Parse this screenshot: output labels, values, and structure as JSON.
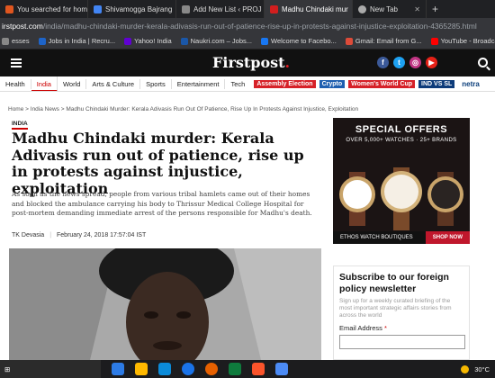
{
  "browser": {
    "tabs": [
      {
        "label": "You searched for hom",
        "color": "#e0561f"
      },
      {
        "label": "Shivamogga Bajrang",
        "color": "#4285f4"
      },
      {
        "label": "Add New List ‹ PROJ",
        "color": "#888888"
      },
      {
        "label": "Madhu Chindaki mur",
        "color": "#d21e1e"
      },
      {
        "label": "New Tab",
        "color": "#aaaaaa"
      }
    ],
    "url_domain": "irstpost.com",
    "url_path": "/india/madhu-chindaki-murder-kerala-adivasis-run-out-of-patience-rise-up-in-protests-against-injustice-exploitation-4365285.html",
    "bookmarks": [
      {
        "label": "esses",
        "color": "#888888"
      },
      {
        "label": "Jobs in India | Recru...",
        "color": "#1e64c8"
      },
      {
        "label": "Yahoo! India",
        "color": "#6001d2"
      },
      {
        "label": "Naukri.com – Jobs...",
        "color": "#1a57a8"
      },
      {
        "label": "Welcome to Facebo...",
        "color": "#1877f2"
      },
      {
        "label": "Gmail: Email from G...",
        "color": "#dd4b39"
      },
      {
        "label": "YouTube - Broadcas...",
        "color": "#ff0000"
      }
    ]
  },
  "site": {
    "logo": "Firstpost",
    "logo_dot": ".",
    "social": [
      {
        "glyph": "f",
        "color": "#3b5998",
        "name": "facebook"
      },
      {
        "glyph": "t",
        "color": "#1da1f2",
        "name": "twitter"
      },
      {
        "glyph": "◎",
        "color": "#c13584",
        "name": "instagram"
      },
      {
        "glyph": "▶",
        "color": "#e62117",
        "name": "youtube"
      }
    ],
    "nav": [
      "Health",
      "India",
      "World",
      "Arts & Culture",
      "Sports",
      "Entertainment",
      "Tech"
    ],
    "nav_selected": "India",
    "pills": [
      {
        "label": "Assembly Election",
        "color": "#d62128"
      },
      {
        "label": "Crypto",
        "color": "#1f5fb0"
      },
      {
        "label": "Women's World Cup",
        "color": "#d62128"
      },
      {
        "label": "IND VS SL",
        "color": "#0d3b7a"
      }
    ],
    "netra": "netra"
  },
  "article": {
    "breadcrumb": [
      "Home",
      "India News",
      "Madhu Chindaki Murder: Kerala Adivasis Run Out Of Patience, Rise Up In Protests Against Injustice, Exploitation"
    ],
    "tag": "INDIA",
    "headline": "Madhu Chindaki murder: Kerala Adivasis run out of patience, rise up in protests against injustice, exploitation",
    "summary": "As soon as the news spread, people from various tribal hamlets came out of their homes and blocked the ambulance carrying his body to Thrissur Medical College Hospital for post-mortem demanding immediate arrest of the persons responsible for Madhu's death.",
    "author": "TK Devasia",
    "date": "February 24, 2018 17:57:04 IST"
  },
  "ad": {
    "title": "SPECIAL OFFERS",
    "subtitle": "OVER 5,000+ WATCHES · 25+ BRANDS",
    "footer_brand": "ETHOS WATCH BOUTIQUES",
    "footer_cta": "SHOP NOW"
  },
  "newsletter": {
    "title": "Subscribe to our foreign policy newsletter",
    "text": "Sign up for a weekly curated briefing of the most important strategic affairs stories from across the world",
    "label": "Email Address",
    "required_mark": "*"
  },
  "taskbar": {
    "temperature": "30°C",
    "apps": [
      "#2d7be5",
      "#ffb900",
      "#0b8bd9",
      "#1a73e8",
      "#e66000",
      "#0f7b3d",
      "#fb542b",
      "#4c8bf5",
      "#888888"
    ]
  }
}
